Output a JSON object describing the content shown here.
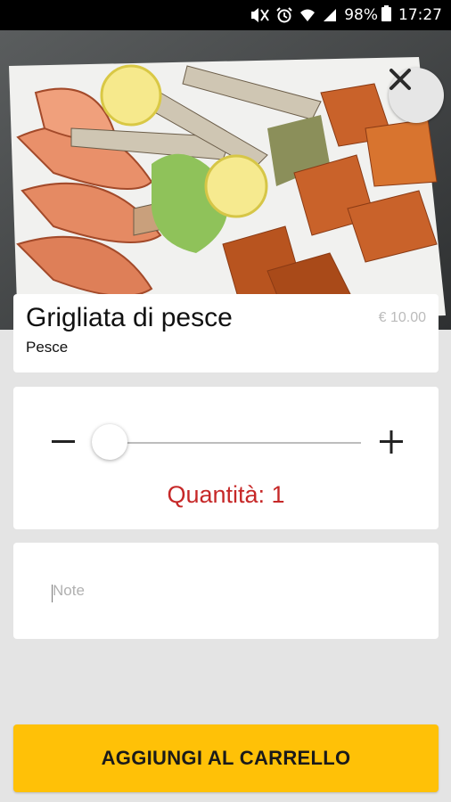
{
  "status_bar": {
    "battery": "98%",
    "time": "17:27",
    "icons": [
      "mute-icon",
      "alarm-icon",
      "wifi-icon",
      "signal-icon",
      "battery-icon"
    ]
  },
  "hero": {
    "image_subject": "grilled fish platter",
    "close_icon": "close-icon"
  },
  "product": {
    "name": "Grigliata di pesce",
    "category": "Pesce",
    "price": "€ 10.00"
  },
  "quantity": {
    "minus_icon": "minus-icon",
    "plus_icon": "plus-icon",
    "label": "Quantità: ",
    "value": "1",
    "slider_fraction": 0,
    "accent_color": "#c62828"
  },
  "notes": {
    "placeholder": "Note"
  },
  "cta": {
    "label": "AGGIUNGI AL CARRELLO",
    "color": "#ffc107"
  }
}
